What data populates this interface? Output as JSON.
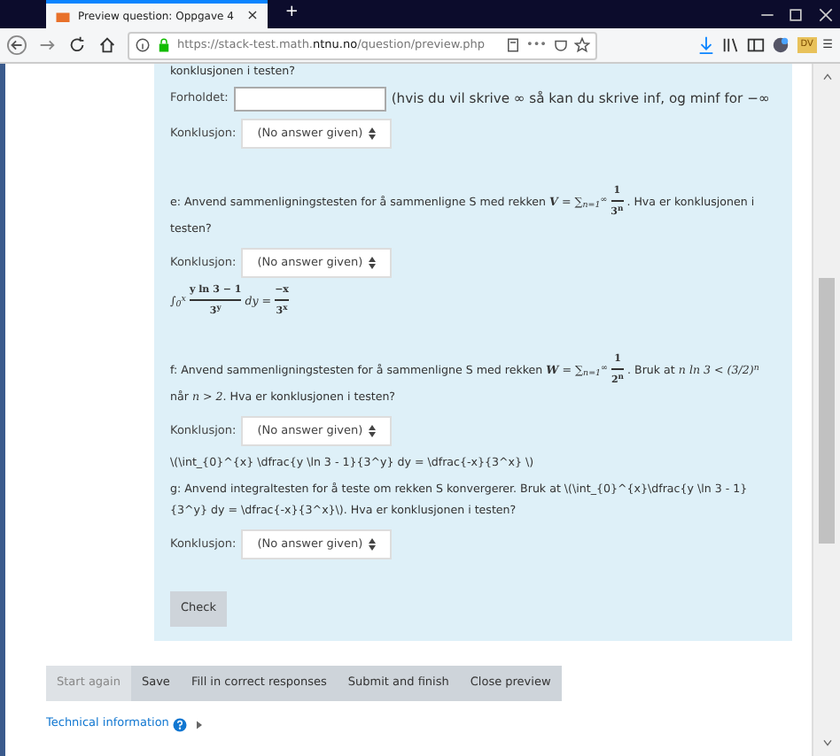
{
  "browser": {
    "tab_title": "Preview question: Oppgave 4",
    "tab_close": "×",
    "new_tab": "+",
    "url_prefix": "https://stack-test.math.",
    "url_domain": "ntnu.no",
    "url_path": "/question/preview.php",
    "more": "•••",
    "ext_badge": "DV",
    "menu": "☰"
  },
  "question": {
    "top_cut_text": "konklusjonen i testen?",
    "items": [
      {
        "kind": "input",
        "label": "Forholdet:",
        "hint": "(hvis du vil skrive ∞ så kan du skrive inf, og minf for −∞"
      },
      {
        "kind": "select",
        "label": "Konklusjon:",
        "value": "(No answer given)"
      },
      {
        "kind": "gap"
      },
      {
        "kind": "para",
        "parts": [
          {
            "kind": "text",
            "text": "e: Anvend sammenligningstesten for å sammenligne S med rekken "
          },
          {
            "kind": "math",
            "text": "**V** = ∑$_{n=1}$$^{∞}$"
          },
          {
            "kind": "frac",
            "num": "1",
            "den": "3$^{n}$"
          },
          {
            "kind": "text",
            "text": ". Hva er konklusjonen i testen?"
          }
        ]
      },
      {
        "kind": "select",
        "label": "Konklusjon:",
        "value": "(No answer given)"
      },
      {
        "kind": "para",
        "parts": [
          {
            "kind": "math",
            "text": "∫$_{0}$$^{x}$"
          },
          {
            "kind": "frac",
            "num": "y ln 3 − 1",
            "den": "3$^{y}$"
          },
          {
            "kind": "math",
            "text": "dy ="
          },
          {
            "kind": "frac",
            "num": "−x",
            "den": "3$^{x}$"
          }
        ]
      },
      {
        "kind": "gap"
      },
      {
        "kind": "para",
        "parts": [
          {
            "kind": "text",
            "text": "f: Anvend sammenligningstesten for å sammenligne S med rekken "
          },
          {
            "kind": "math",
            "text": "**W** = ∑$_{n=1}$$^{∞}$"
          },
          {
            "kind": "frac",
            "num": "1",
            "den": "2$^{n}$"
          },
          {
            "kind": "text",
            "text": ". Bruk at "
          },
          {
            "kind": "math",
            "text": "n ln 3 < (3/2)$^{n}$"
          },
          {
            "kind": "text",
            "text": " når "
          },
          {
            "kind": "math",
            "text": "n > 2"
          },
          {
            "kind": "text",
            "text": ". Hva er konklusjonen i testen?"
          }
        ]
      },
      {
        "kind": "select",
        "label": "Konklusjon:",
        "value": "(No answer given)"
      },
      {
        "kind": "para",
        "parts": [
          {
            "kind": "text",
            "text": "\\(\\int_{0}^{x} \\dfrac{y \\ln 3 - 1}{3^y} dy = \\dfrac{-x}{3^x} \\)"
          }
        ]
      },
      {
        "kind": "para",
        "parts": [
          {
            "kind": "text",
            "text": "g: Anvend integraltesten for å teste om rekken S konvergerer. Bruk at \\(\\int_{0}^{x}\\dfrac{y \\ln 3 - 1}{3^y} dy = \\dfrac{-x}{3^x}\\). Hva er konklusjonen i testen?"
          }
        ]
      },
      {
        "kind": "select",
        "label": "Konklusjon:",
        "value": "(No answer given)"
      },
      {
        "kind": "gap"
      }
    ],
    "check": "Check"
  },
  "actions": [
    {
      "label": "Start again",
      "disabled": true
    },
    {
      "label": "Save",
      "disabled": false
    },
    {
      "label": "Fill in correct responses",
      "disabled": false
    },
    {
      "label": "Submit and finish",
      "disabled": false
    },
    {
      "label": "Close preview",
      "disabled": false
    }
  ],
  "tech_info": "Technical information"
}
